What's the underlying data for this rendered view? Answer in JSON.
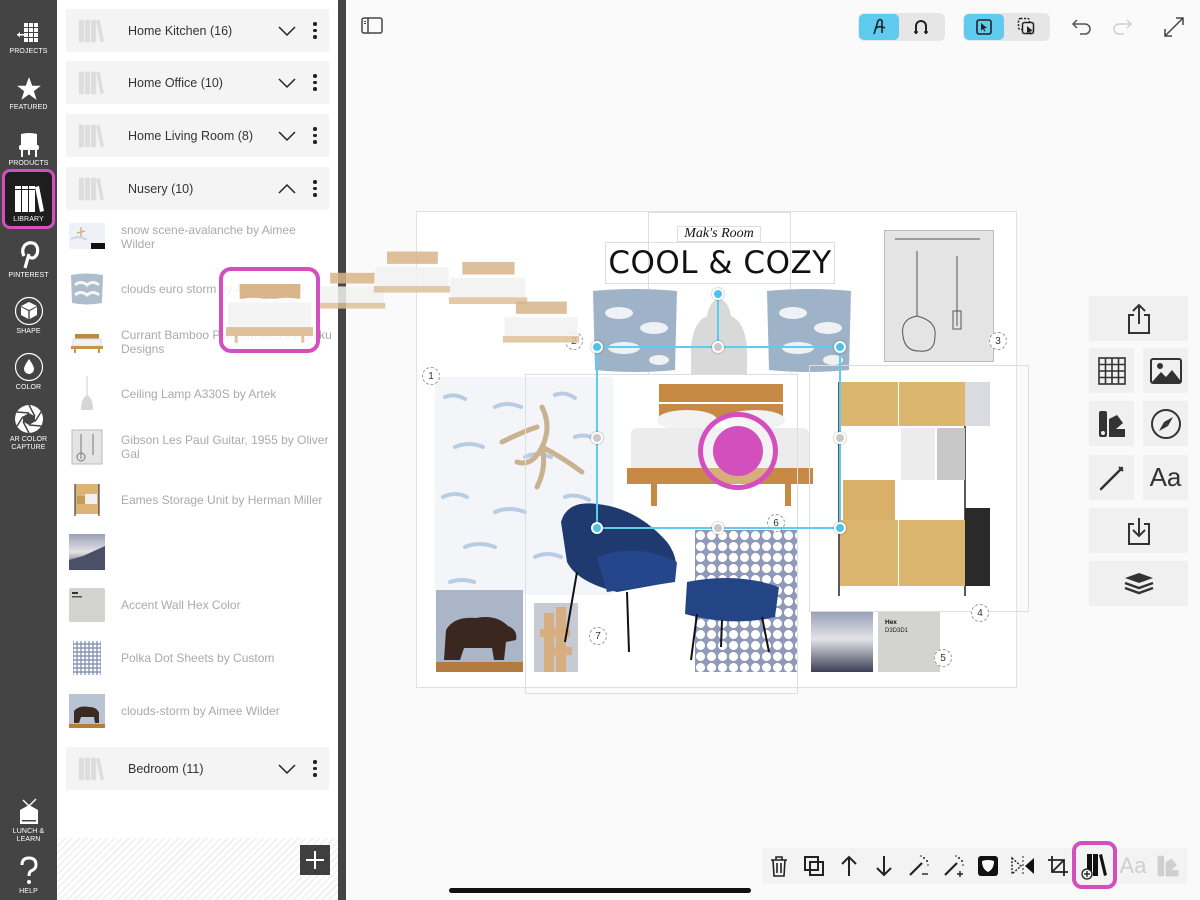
{
  "rail": {
    "items": [
      {
        "label": "PROJECTS",
        "icon": "projects-grid-icon"
      },
      {
        "label": "FEATURED",
        "icon": "star-icon"
      },
      {
        "label": "PRODUCTS",
        "icon": "chair-icon"
      },
      {
        "label": "LIBRARY",
        "icon": "library-books-icon",
        "active": true
      },
      {
        "label": "PINTEREST",
        "icon": "pinterest-icon"
      },
      {
        "label": "SHAPE",
        "icon": "cube-icon"
      },
      {
        "label": "COLOR",
        "icon": "droplet-icon"
      },
      {
        "label": "AR COLOR CAPTURE",
        "icon": "aperture-icon"
      }
    ],
    "bottom": [
      {
        "label": "LUNCH & LEARN",
        "icon": "tv-icon"
      },
      {
        "label": "HELP",
        "icon": "question-icon"
      }
    ]
  },
  "library": {
    "folders": [
      {
        "name": "Home Kitchen (16)",
        "expanded": false
      },
      {
        "name": "Home Office (10)",
        "expanded": false
      },
      {
        "name": "Home Living Room (8)",
        "expanded": false
      },
      {
        "name": "Nusery (10)",
        "expanded": true
      },
      {
        "name": "Bedroom (11)",
        "expanded": false
      }
    ],
    "items": [
      {
        "label": "snow scene-avalanche by Aimee Wilder"
      },
      {
        "label": "clouds euro storm by Aimee Wilder"
      },
      {
        "label": "Currant Bamboo Platform Bed by Haiku Designs"
      },
      {
        "label": "Ceiling Lamp A330S by Artek"
      },
      {
        "label": "Gibson Les Paul Guitar, 1955 by Oliver Gal"
      },
      {
        "label": "Eames Storage Unit by Herman Miller"
      },
      {
        "label": ""
      },
      {
        "label": "Accent Wall Hex Color"
      },
      {
        "label": "Polka Dot Sheets by Custom"
      },
      {
        "label": "clouds-storm by Aimee Wilder"
      }
    ],
    "add_label": "+"
  },
  "toolbar": {
    "sidebar_toggle": "sidebar-toggle-icon",
    "draw_mode": {
      "options": [
        "freehand-icon",
        "magnet-icon"
      ],
      "selected": 0
    },
    "select_mode": {
      "options": [
        "select-arrow-icon",
        "multi-select-icon"
      ],
      "selected": 0
    },
    "undo": "undo-icon",
    "redo": "redo-icon",
    "fullscreen": "expand-icon"
  },
  "board": {
    "subtitle": "Mak's Room",
    "title": "COOL & COZY",
    "hex_label": "Hex",
    "hex_value": "D3D3D1",
    "badges": [
      "1",
      "2",
      "3",
      "4",
      "5",
      "6",
      "7"
    ]
  },
  "right_tools": [
    "share-icon",
    "grid-icon",
    "image-icon",
    "swatch-icon",
    "compass-icon",
    "pencil-icon",
    "text-icon",
    "import-icon",
    "layers-icon"
  ],
  "right_text_label": "Aa",
  "bottom_tools": [
    "trash-icon",
    "duplicate-icon",
    "bring-forward-icon",
    "send-backward-icon",
    "magic-wand-minus-icon",
    "magic-wand-plus-icon",
    "mask-icon",
    "flip-icon",
    "crop-icon",
    "add-to-library-icon",
    "text-style-icon",
    "color-swatch-icon"
  ],
  "bottom_text_label": "Aa",
  "colors": {
    "accent": "#5fcbee",
    "highlight": "#d34fbd",
    "rail_bg": "#444444",
    "hex_swatch": "#d3d3d1"
  }
}
